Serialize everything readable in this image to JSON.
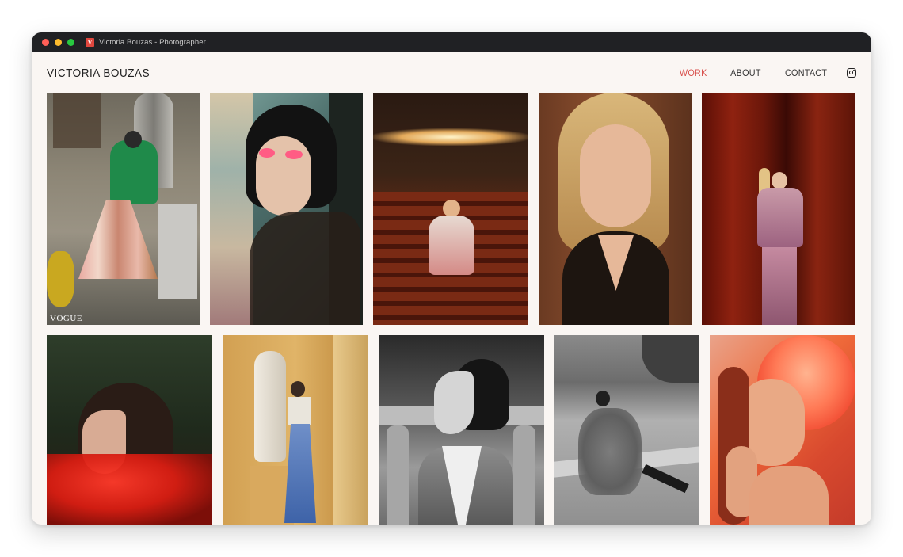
{
  "window": {
    "tab_title": "Victoria Bouzas - Photographer",
    "favicon_letter": "V"
  },
  "site": {
    "brand": "VICTORIA BOUZAS",
    "nav": [
      {
        "label": "WORK",
        "active": true
      },
      {
        "label": "ABOUT",
        "active": false
      },
      {
        "label": "CONTACT",
        "active": false
      }
    ],
    "social_icon": "instagram-icon",
    "accent_color": "#d9534f"
  },
  "gallery": {
    "row1": [
      {
        "name": "fashion-street-green-top",
        "caption": "VOGUE"
      },
      {
        "name": "portrait-pink-eyeshadow",
        "caption": ""
      },
      {
        "name": "theater-seats-portrait",
        "caption": ""
      },
      {
        "name": "blonde-closeup-portrait",
        "caption": ""
      },
      {
        "name": "red-curtain-portrait",
        "caption": ""
      }
    ],
    "row2": [
      {
        "name": "red-tulle-profile",
        "caption": ""
      },
      {
        "name": "statue-blue-skirt",
        "caption": ""
      },
      {
        "name": "bw-profile-balustrade",
        "caption": ""
      },
      {
        "name": "bw-seated-park",
        "caption": ""
      },
      {
        "name": "red-orange-headpiece",
        "caption": ""
      }
    ]
  }
}
